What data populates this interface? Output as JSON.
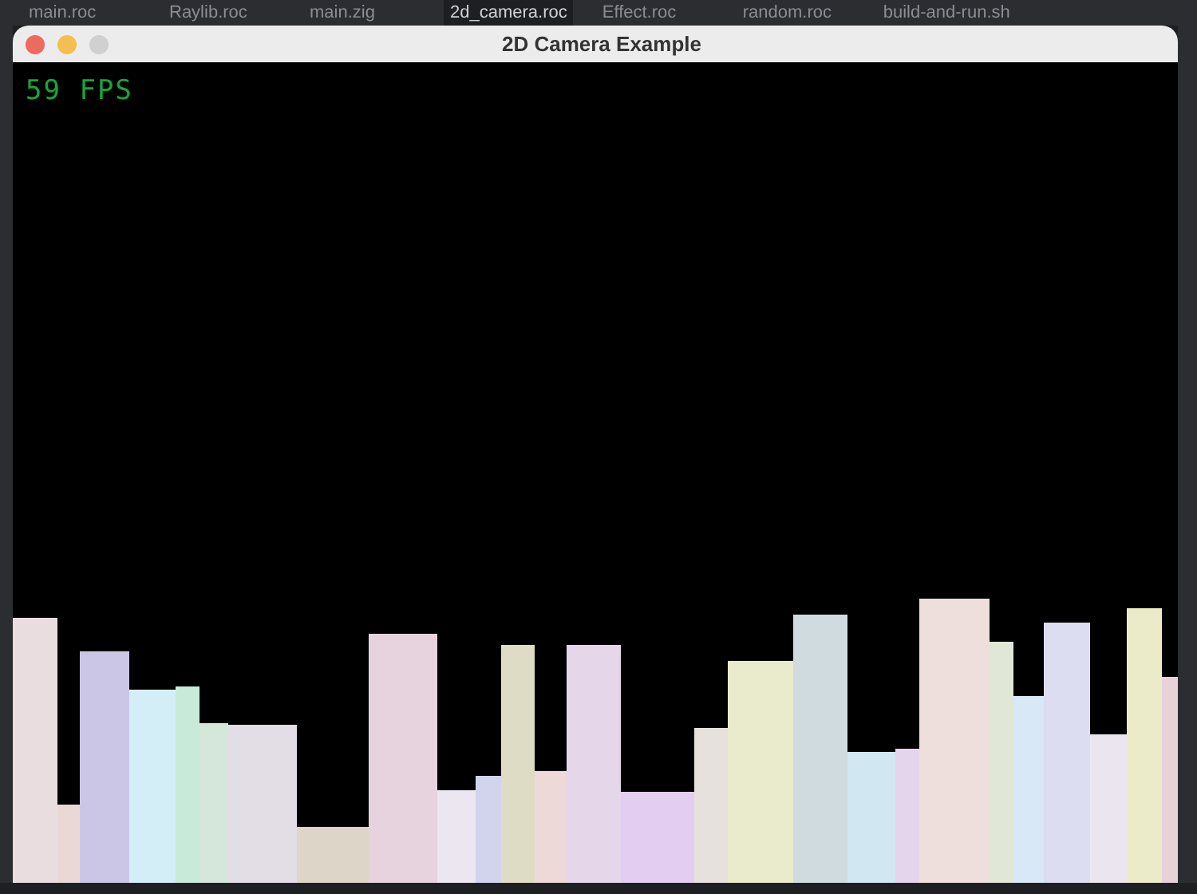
{
  "editor_tabs": [
    {
      "label": "main.roc",
      "selected": false
    },
    {
      "label": "Raylib.roc",
      "selected": false
    },
    {
      "label": "main.zig",
      "selected": false
    },
    {
      "label": "2d_camera.roc",
      "selected": true
    },
    {
      "label": "Effect.roc",
      "selected": false
    },
    {
      "label": "random.roc",
      "selected": false
    },
    {
      "label": "build-and-run.sh",
      "selected": false
    }
  ],
  "window": {
    "title": "2D Camera Example"
  },
  "game": {
    "fps_text": "59 FPS"
  }
}
